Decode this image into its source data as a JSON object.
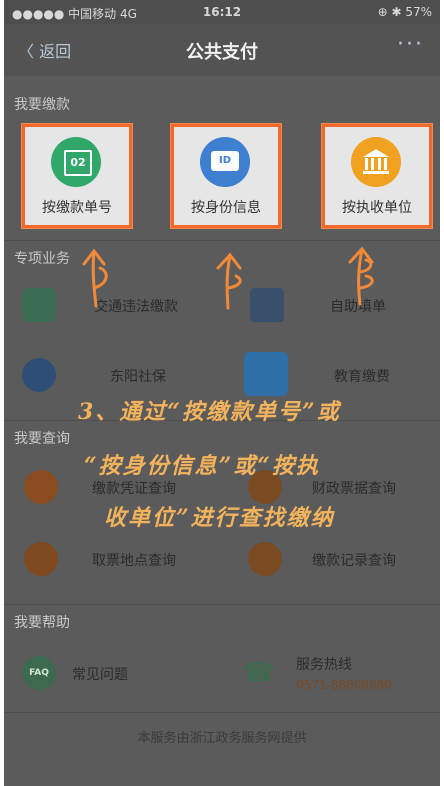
{
  "status": {
    "carrier": "●●●●● 中国移动  4G",
    "time": "16:12",
    "battery": "⊕ ✱ 57%"
  },
  "navbar": {
    "back_label": "〈 返回",
    "title": "公共支付",
    "more_label": "···"
  },
  "sections": {
    "pay": "我要缴款",
    "special": "专项业务",
    "query": "我要查询",
    "help": "我要帮助"
  },
  "pay_cards": [
    {
      "label": "按缴款单号",
      "icon_text": "02",
      "color": "#2fa86a"
    },
    {
      "label": "按身份信息",
      "icon_text": "ID",
      "color": "#3e7fd0"
    },
    {
      "label": "按执收单位",
      "icon_text": "",
      "color": "#f0a120"
    }
  ],
  "special_items": [
    {
      "label": "交通违法缴款"
    },
    {
      "label": "自助填单"
    },
    {
      "label": "东阳社保"
    },
    {
      "label": "教育缴费"
    }
  ],
  "query_items": [
    {
      "label": "缴款凭证查询"
    },
    {
      "label": "财政票据查询"
    },
    {
      "label": "取票地点查询"
    },
    {
      "label": "缴款记录查询"
    }
  ],
  "help_items": [
    {
      "label": "常见问题",
      "icon_text": "FAQ"
    },
    {
      "label": "服务热线",
      "phone": "0571-88808880"
    }
  ],
  "footer": "本服务由浙江政务服务网提供",
  "annotation": {
    "line1": "3、通过“按缴款单号”或",
    "line2": "“按身份信息”或“按执",
    "line3": "收单位”进行查找缴纳"
  },
  "colors": {
    "highlight": "#f2692a",
    "handwriting": "#f3b35c"
  }
}
